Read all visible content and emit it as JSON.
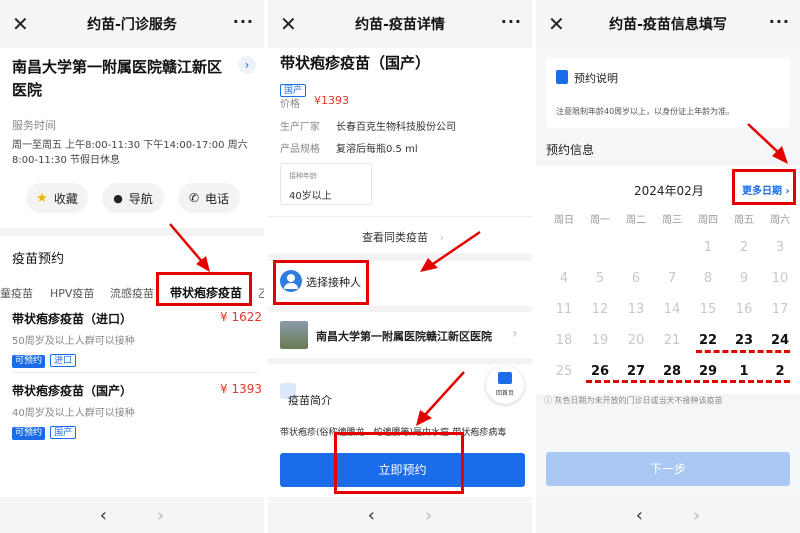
{
  "panel1": {
    "title": "约苗-门诊服务",
    "close": "✕",
    "more": "···",
    "hospital_name": "南昌大学第一附属医院赣江新区医院",
    "service_time_label": "服务时间",
    "service_time": "周一至周五 上午8:00-11:30 下午14:00-17:00 周六8:00-11:30 节假日休息",
    "actions": {
      "favorite": "收藏",
      "navigate": "导航",
      "phone": "电话"
    },
    "section_title": "疫苗预约",
    "tabs": [
      "童疫苗",
      "HPV疫苗",
      "流感疫苗",
      "带状疱疹疫苗",
      "乙"
    ],
    "vaccines": [
      {
        "name": "带状疱疹疫苗（进口）",
        "price": "¥ 1622",
        "desc": "50周岁及以上人群可以接种",
        "tag1": "可预约",
        "tag2": "进口"
      },
      {
        "name": "带状疱疹疫苗（国产）",
        "price": "¥ 1393",
        "desc": "40周岁及以上人群可以接种",
        "tag1": "可预约",
        "tag2": "国产"
      }
    ]
  },
  "panel2": {
    "title": "约苗-疫苗详情",
    "close": "✕",
    "more": "···",
    "vaccine_name": "带状疱疹疫苗（国产）",
    "tag": "国产",
    "price_label": "价格",
    "price": "¥1393",
    "maker_label": "生产厂家",
    "maker": "长春百克生物科技股份公司",
    "spec_label": "产品规格",
    "spec": "复溶后每瓶0.5 ml",
    "age_label": "接种年龄",
    "age": "40岁以上",
    "similar": "查看同类疫苗",
    "choose_person": "选择接种人",
    "hospital": "南昌大学第一附属医院赣江新区医院",
    "home": "回首页",
    "intro_title": "疫苗简介",
    "intro_text": "带状疱疹(俗称缠腰龙、蛇缠腰等)是由水痘-带状疱疹病毒",
    "book_button": "立即预约"
  },
  "panel3": {
    "title": "约苗-疫苗信息填写",
    "close": "✕",
    "more": "···",
    "notice_title": "预约说明",
    "notice_text": "注意限制年龄40周岁以上，以身份证上年龄为准。",
    "booking_info": "预约信息",
    "month": "2024年02月",
    "more_dates": "更多日期 ›",
    "weekdays": [
      "周日",
      "周一",
      "周二",
      "周三",
      "周四",
      "周五",
      "周六"
    ],
    "weeks": [
      [
        "",
        "",
        "",
        "",
        "1",
        "2",
        "3"
      ],
      [
        "4",
        "5",
        "6",
        "7",
        "8",
        "9",
        "10"
      ],
      [
        "11",
        "12",
        "13",
        "14",
        "15",
        "16",
        "17"
      ],
      [
        "18",
        "19",
        "20",
        "21",
        "22",
        "23",
        "24"
      ],
      [
        "25",
        "26",
        "27",
        "28",
        "29",
        "1",
        "2"
      ]
    ],
    "legend": "灰色日期为未开放的门诊日或当天不接种该疫苗",
    "next_button": "下一步"
  },
  "colors": {
    "accent": "#1a6ce8",
    "price": "#e0352b",
    "annotation": "#e50000"
  }
}
